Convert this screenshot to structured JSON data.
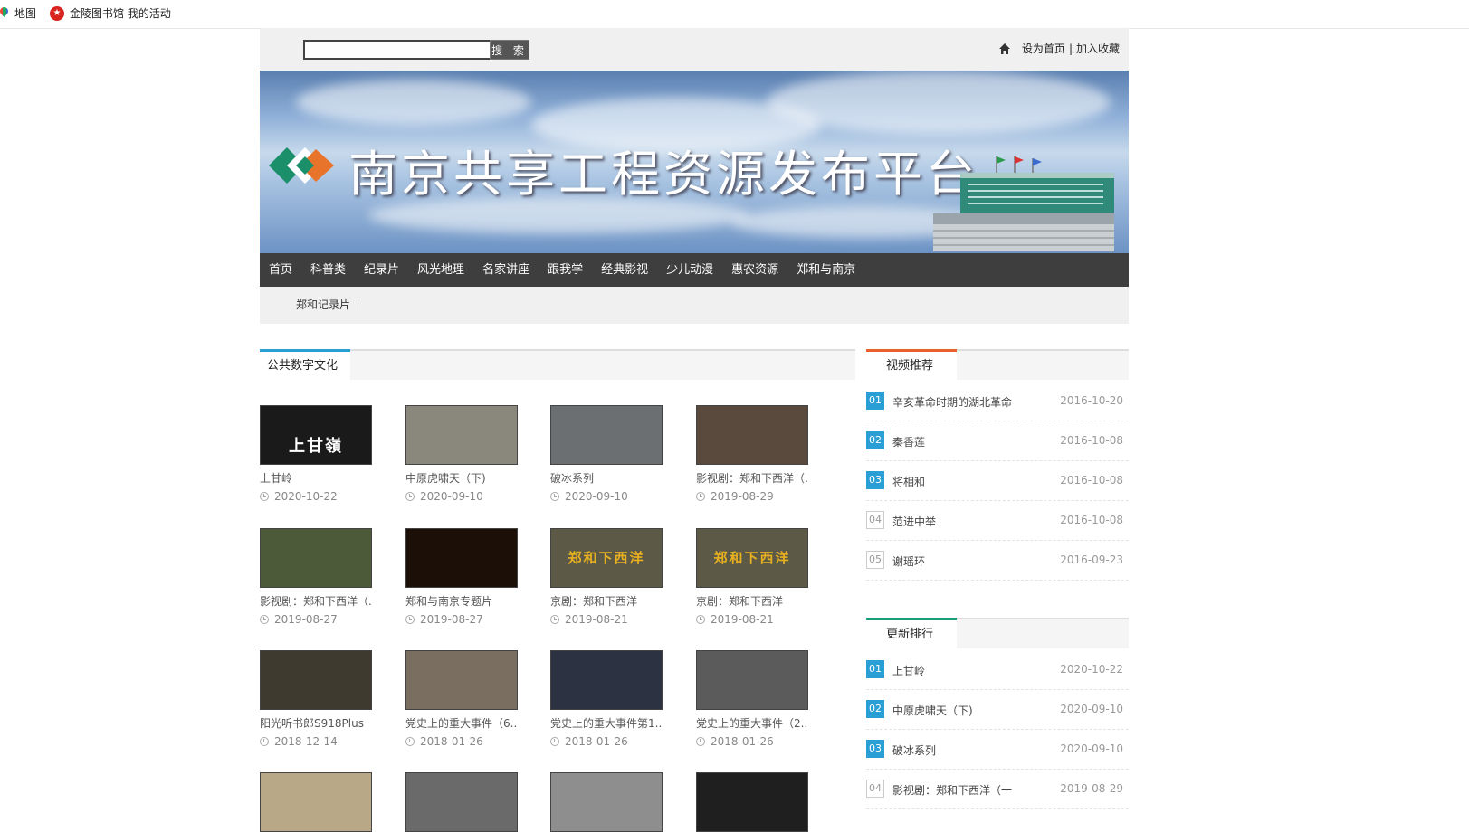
{
  "bookmarks": [
    {
      "label": "地图"
    },
    {
      "label": "金陵图书馆 我的活动"
    }
  ],
  "search": {
    "placeholder": "",
    "button_label": "搜 索"
  },
  "toplinks": {
    "home_label": "设为首页",
    "separator": "|",
    "fav_label": "加入收藏"
  },
  "banner": {
    "title": "南京共享工程资源发布平台"
  },
  "nav": [
    "首页",
    "科普类",
    "纪录片",
    "风光地理",
    "名家讲座",
    "跟我学",
    "经典影视",
    "少儿动漫",
    "惠农资源",
    "郑和与南京"
  ],
  "subnav": [
    "郑和记录片"
  ],
  "section": {
    "title": "公共数字文化"
  },
  "videos": [
    {
      "title": "上甘岭",
      "date": "2020-10-22",
      "thumb_bg": "#1a1a1a",
      "thumb_text": "上甘嶺"
    },
    {
      "title": "中原虎啸天（下)",
      "date": "2020-09-10",
      "thumb_bg": "#8a877c",
      "thumb_text": ""
    },
    {
      "title": "破冰系列",
      "date": "2020-09-10",
      "thumb_bg": "#6b6f72",
      "thumb_text": ""
    },
    {
      "title": "影视剧：郑和下西洋（...",
      "date": "2019-08-29",
      "thumb_bg": "#5a4a3e",
      "thumb_text": ""
    },
    {
      "title": "影视剧：郑和下西洋（...",
      "date": "2019-08-27",
      "thumb_bg": "#4d5a3a",
      "thumb_text": ""
    },
    {
      "title": "郑和与南京专题片",
      "date": "2019-08-27",
      "thumb_bg": "#1b0f08",
      "thumb_text": ""
    },
    {
      "title": "京剧：郑和下西洋",
      "date": "2019-08-21",
      "thumb_bg": "#5c5a46",
      "thumb_text": "郑和下西洋"
    },
    {
      "title": "京剧：郑和下西洋",
      "date": "2019-08-21",
      "thumb_bg": "#5c5a46",
      "thumb_text": "郑和下西洋"
    },
    {
      "title": "阳光听书郎S918Plus",
      "date": "2018-12-14",
      "thumb_bg": "#3e3a30",
      "thumb_text": ""
    },
    {
      "title": "党史上的重大事件（6...",
      "date": "2018-01-26",
      "thumb_bg": "#7a6e60",
      "thumb_text": ""
    },
    {
      "title": "党史上的重大事件第1...",
      "date": "2018-01-26",
      "thumb_bg": "#2d3242",
      "thumb_text": ""
    },
    {
      "title": "党史上的重大事件（2...",
      "date": "2018-01-26",
      "thumb_bg": "#5b5b5b",
      "thumb_text": ""
    },
    {
      "title": "",
      "date": "",
      "thumb_bg": "#b8a888",
      "thumb_text": ""
    },
    {
      "title": "",
      "date": "",
      "thumb_bg": "#6a6a6a",
      "thumb_text": ""
    },
    {
      "title": "",
      "date": "",
      "thumb_bg": "#8e8e8e",
      "thumb_text": ""
    },
    {
      "title": "",
      "date": "",
      "thumb_bg": "#1f1f1f",
      "thumb_text": ""
    }
  ],
  "recommend": {
    "title": "视频推荐",
    "accent": "#e8602c",
    "items": [
      {
        "num": "01",
        "title": "辛亥革命时期的湖北革命",
        "date": "2016-10-20"
      },
      {
        "num": "02",
        "title": "秦香莲",
        "date": "2016-10-08"
      },
      {
        "num": "03",
        "title": "将相和",
        "date": "2016-10-08"
      },
      {
        "num": "04",
        "title": "范进中举",
        "date": "2016-10-08"
      },
      {
        "num": "05",
        "title": "谢瑶环",
        "date": "2016-09-23"
      }
    ]
  },
  "ranking": {
    "title": "更新排行",
    "accent": "#1aa07a",
    "items": [
      {
        "num": "01",
        "title": "上甘岭",
        "date": "2020-10-22"
      },
      {
        "num": "02",
        "title": "中原虎啸天（下)",
        "date": "2020-09-10"
      },
      {
        "num": "03",
        "title": "破冰系列",
        "date": "2020-09-10"
      },
      {
        "num": "04",
        "title": "影视剧：郑和下西洋（一",
        "date": "2019-08-29"
      }
    ]
  }
}
